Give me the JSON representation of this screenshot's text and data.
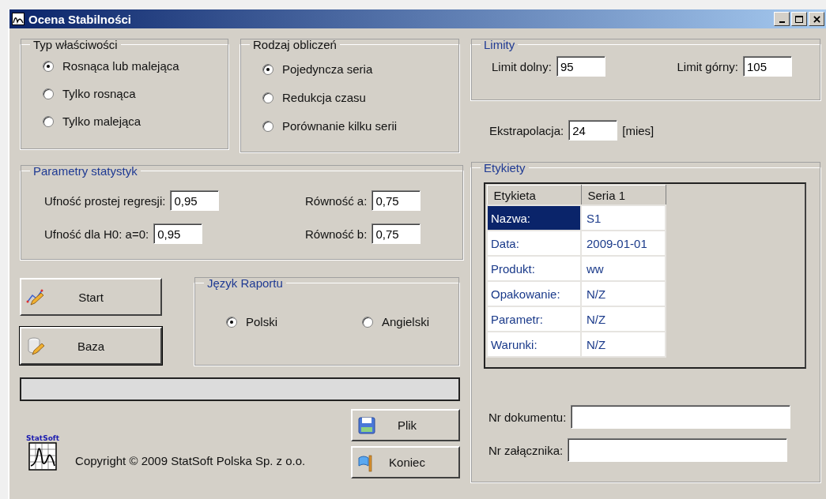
{
  "window": {
    "title": "Ocena Stabilności"
  },
  "property_type": {
    "title": "Typ właściwości",
    "options": [
      {
        "label": "Rosnąca lub malejąca",
        "selected": true
      },
      {
        "label": "Tylko rosnąca",
        "selected": false
      },
      {
        "label": "Tylko malejąca",
        "selected": false
      }
    ]
  },
  "calculation_type": {
    "title": "Rodzaj obliczeń",
    "options": [
      {
        "label": "Pojedyncza seria",
        "selected": true
      },
      {
        "label": "Redukcja czasu",
        "selected": false
      },
      {
        "label": "Porównanie kilku serii",
        "selected": false
      }
    ]
  },
  "statistics_parameters": {
    "title": "Parametry statystyk",
    "fields": [
      {
        "label": "Ufność prostej regresji:",
        "value": "0,95"
      },
      {
        "label": "Równość a:",
        "value": "0,75"
      },
      {
        "label": "Ufność dla H0: a=0:",
        "value": "0,95"
      },
      {
        "label": "Równość b:",
        "value": "0,75"
      }
    ]
  },
  "action_buttons": [
    {
      "label": "Start",
      "kind": "chart",
      "default": false
    },
    {
      "label": "Baza",
      "kind": "database",
      "default": true
    }
  ],
  "report_language": {
    "title": "Język Raportu",
    "options": [
      {
        "label": "Polski",
        "selected": true
      },
      {
        "label": "Angielski",
        "selected": false
      }
    ]
  },
  "progress": {
    "level": 0
  },
  "logo_text": "StatSoft",
  "copyright": "Copyright © 2009 StatSoft Polska Sp. z o.o.",
  "file_buttons": [
    {
      "label": "Plik",
      "kind": "save"
    },
    {
      "label": "Koniec",
      "kind": "exit"
    }
  ],
  "limits": {
    "title": "Limity",
    "fields": [
      {
        "label": "Limit dolny:",
        "value": "95"
      },
      {
        "label": "Limit górny:",
        "value": "105"
      }
    ]
  },
  "extrapolation": {
    "label": "Ekstrapolacja:",
    "value": "24",
    "unit": "[mies]"
  },
  "labels": {
    "title": "Etykiety",
    "columns": [
      "Etykieta",
      "Seria 1"
    ],
    "rows": [
      {
        "label": "Nazwa:",
        "value": "S1",
        "selected": true
      },
      {
        "label": "Data:",
        "value": "2009-01-01",
        "selected": false
      },
      {
        "label": "Produkt:",
        "value": "ww",
        "selected": false
      },
      {
        "label": "Opakowanie:",
        "value": "N/Z",
        "selected": false
      },
      {
        "label": "Parametr:",
        "value": "N/Z",
        "selected": false
      },
      {
        "label": "Warunki:",
        "value": "N/Z",
        "selected": false
      }
    ]
  },
  "document_fields": [
    {
      "label": "Nr dokumentu:"
    },
    {
      "label": "Nr załącznika:"
    }
  ]
}
